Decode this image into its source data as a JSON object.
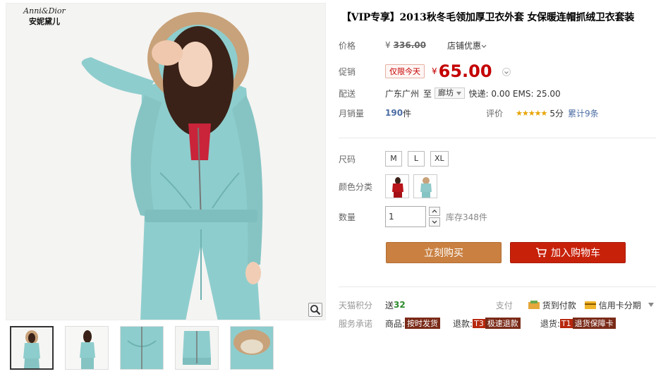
{
  "brand": {
    "script": "Anni&Dior",
    "cn": "安妮黛儿"
  },
  "product": {
    "title": "【VIP专享】2013秋冬毛领加厚卫衣外套 女保暖连帽抓绒卫衣套装"
  },
  "price": {
    "label": "价格",
    "currency": "¥",
    "original": "336.00",
    "dropdown": "店铺优惠"
  },
  "promo": {
    "label": "促销",
    "badge": "仅限今天",
    "currency": "¥",
    "value": "65.00"
  },
  "shipping": {
    "label": "配送",
    "from": "广东广州",
    "to_word": "至",
    "destination": "廊坊",
    "fees": "快递: 0.00 EMS: 25.00"
  },
  "sales": {
    "label": "月销量",
    "count": "190",
    "unit": "件",
    "rating_label": "评价",
    "stars": "★★★★★",
    "score": "5分",
    "reviews": "累计9条"
  },
  "size": {
    "label": "尺码",
    "options": [
      "M",
      "L",
      "XL"
    ]
  },
  "colors": {
    "label": "颜色分类",
    "swatches": [
      "#b8141a",
      "#8fc9c9"
    ]
  },
  "quantity": {
    "label": "数量",
    "value": "1",
    "stock": "库存348件"
  },
  "actions": {
    "buy": "立刻购买",
    "cart": "加入购物车"
  },
  "points": {
    "label": "天猫积分",
    "send": "送",
    "value": "32",
    "pay_label": "支付",
    "cod": "货到付款",
    "installment": "信用卡分期"
  },
  "service": {
    "label": "服务承诺",
    "goods_prefix": "商品:",
    "goods_tag": "按时发货",
    "refund_prefix": "退款:",
    "refund_code": "T3",
    "refund_tag": "极速退款",
    "return_prefix": "退货:",
    "return_code": "T1",
    "return_tag": "退货保障卡"
  },
  "theme": {
    "price_red": "#c40000",
    "buy_orange": "#c98041",
    "cart_red": "#c8210a",
    "link_blue": "#4b6ca3",
    "hoodie_mint": "#8ecdcd"
  }
}
